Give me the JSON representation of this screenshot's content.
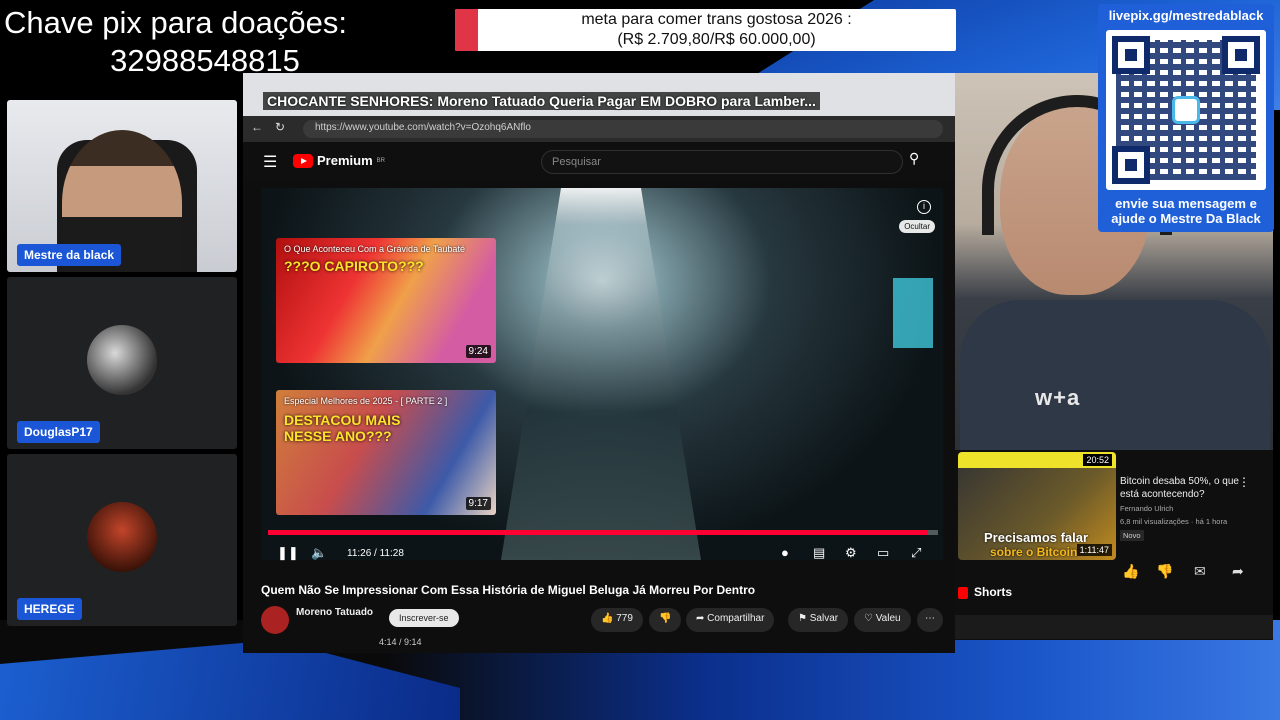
{
  "overlay": {
    "pix_line1": "Chave pix para doações:",
    "pix_line2": "32988548815",
    "goal_text_line1": "meta para comer trans gostosa 2026 :",
    "goal_text_line2": "(R$ 2.709,80/R$ 60.000,00)",
    "goal_progress": 0.045,
    "qr_link": "livepix.gg/mestredablack",
    "qr_message_line1": "envie sua mensagem e",
    "qr_message_line2": "ajude o Mestre Da Black"
  },
  "participants": [
    {
      "name": "Mestre da black"
    },
    {
      "name": "DouglasP17"
    },
    {
      "name": "HEREGE"
    }
  ],
  "browser": {
    "tab_title": "CHOCANTE SENHORES: Moreno Tatuado Queria Pagar EM DOBRO para Lamber...",
    "url": "https://www.youtube.com/watch?v=Ozohq6ANflo"
  },
  "youtube": {
    "logo_text": "Premium",
    "logo_sup": "BR",
    "search_placeholder": "Pesquisar",
    "hide_label": "Ocultar",
    "endcards": [
      {
        "title": "O Que Aconteceu Com a Grávida de Taubaté",
        "big": "???O CAPIROTO???",
        "duration": "9:24"
      },
      {
        "title": "Especial Melhores de 2025 - [ PARTE 2 ]",
        "big": "DESTACOU MAIS NESSE ANO???",
        "duration": "9:17"
      }
    ],
    "progress": 0.985,
    "time": "11:26 / 11:28",
    "video_title": "Quem Não Se Impressionar Com Essa História de Miguel Beluga Já Morreu Por Dentro",
    "channel": "Moreno Tatuado",
    "subscribe": "Inscrever-se",
    "likes": "779",
    "share": "Compartilhar",
    "save": "Salvar",
    "thanks": "Valeu",
    "mini_time": "4:14 / 9:14"
  },
  "side_video": {
    "duration_top": "20:52",
    "duration": "1:11:47",
    "caption1": "Precisamos falar",
    "caption2": "sobre o Bitcoin",
    "title": "Bitcoin desaba 50%, o que está acontecendo?",
    "channel": "Fernando Ulrich",
    "views": "6,8 mil visualizações · há 1 hora",
    "badge": "Novo",
    "shorts_label": "Shorts"
  },
  "colors": {
    "accent_red": "#e03547",
    "chip_blue": "#1a56d6",
    "yt_red": "#ff0033"
  }
}
